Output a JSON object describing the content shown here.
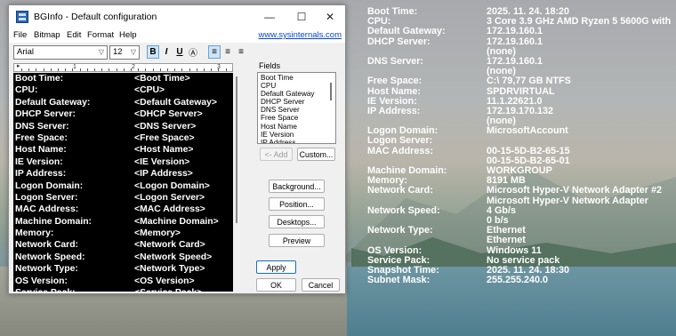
{
  "window": {
    "title": "BGInfo - Default configuration",
    "controls": {
      "minimize": "—",
      "maximize": "☐",
      "close": "✕"
    }
  },
  "menubar": {
    "items": [
      "File",
      "Bitmap",
      "Edit",
      "Format",
      "Help"
    ],
    "link": "www.sysinternals.com"
  },
  "toolbar": {
    "font_name": "Arial",
    "font_size": "12",
    "buttons": {
      "bold": "B",
      "italic": "I",
      "underline": "U",
      "format": "Ⓐ",
      "align_left": "≡",
      "align_center": "≡",
      "align_right": "≡"
    }
  },
  "ruler": {
    "labels": [
      "1",
      "2",
      "3"
    ]
  },
  "editor": {
    "rows": [
      {
        "key": "Boot Time:",
        "value": "<Boot Time>"
      },
      {
        "key": "CPU:",
        "value": "<CPU>"
      },
      {
        "key": "Default Gateway:",
        "value": "<Default Gateway>"
      },
      {
        "key": "DHCP Server:",
        "value": "<DHCP Server>"
      },
      {
        "key": "DNS Server:",
        "value": "<DNS Server>"
      },
      {
        "key": "Free Space:",
        "value": "<Free Space>"
      },
      {
        "key": "Host Name:",
        "value": "<Host Name>"
      },
      {
        "key": "IE Version:",
        "value": "<IE Version>"
      },
      {
        "key": "IP Address:",
        "value": "<IP Address>"
      },
      {
        "key": "Logon Domain:",
        "value": "<Logon Domain>"
      },
      {
        "key": "Logon Server:",
        "value": "<Logon Server>"
      },
      {
        "key": "MAC Address:",
        "value": "<MAC Address>"
      },
      {
        "key": "Machine Domain:",
        "value": "<Machine Domain>"
      },
      {
        "key": "Memory:",
        "value": "<Memory>"
      },
      {
        "key": "Network Card:",
        "value": "<Network Card>"
      },
      {
        "key": "Network Speed:",
        "value": "<Network Speed>"
      },
      {
        "key": "Network Type:",
        "value": "<Network Type>"
      },
      {
        "key": "OS Version:",
        "value": "<OS Version>"
      },
      {
        "key": "Service Pack:",
        "value": "<Service Pack>"
      }
    ]
  },
  "fields": {
    "label": "Fields",
    "items": [
      "Boot Time",
      "CPU",
      "Default Gateway",
      "DHCP Server",
      "DNS Server",
      "Free Space",
      "Host Name",
      "IE Version",
      "IP Address"
    ]
  },
  "buttons": {
    "add": "<- Add",
    "custom": "Custom...",
    "background": "Background...",
    "position": "Position...",
    "desktops": "Desktops...",
    "preview": "Preview",
    "apply": "Apply",
    "ok": "OK",
    "cancel": "Cancel"
  },
  "desktop_info": {
    "rows": [
      {
        "key": "Boot Time:",
        "value": "2025. 11. 24. 18:20"
      },
      {
        "key": "CPU:",
        "value": "3 Core 3.9 GHz AMD Ryzen 5 5600G with"
      },
      {
        "key": "Default Gateway:",
        "value": "172.19.160.1"
      },
      {
        "key": "DHCP Server:",
        "value": "172.19.160.1"
      },
      {
        "key": "",
        "value": "(none)"
      },
      {
        "key": "DNS Server:",
        "value": "172.19.160.1"
      },
      {
        "key": "",
        "value": "(none)"
      },
      {
        "key": "Free Space:",
        "value": "C:\\ 79,77 GB NTFS"
      },
      {
        "key": "Host Name:",
        "value": "SPDRVIRTUAL"
      },
      {
        "key": "IE Version:",
        "value": "11.1.22621.0"
      },
      {
        "key": "IP Address:",
        "value": "172.19.170.132"
      },
      {
        "key": "",
        "value": "(none)"
      },
      {
        "key": "Logon Domain:",
        "value": "MicrosoftAccount"
      },
      {
        "key": "Logon Server:",
        "value": ""
      },
      {
        "key": "MAC Address:",
        "value": "00-15-5D-B2-65-15"
      },
      {
        "key": "",
        "value": "00-15-5D-B2-65-01"
      },
      {
        "key": "Machine Domain:",
        "value": "WORKGROUP"
      },
      {
        "key": "Memory:",
        "value": "8191 MB"
      },
      {
        "key": "Network Card:",
        "value": "Microsoft Hyper-V Network Adapter #2"
      },
      {
        "key": "",
        "value": "Microsoft Hyper-V Network Adapter"
      },
      {
        "key": "Network Speed:",
        "value": "4 Gb/s"
      },
      {
        "key": "",
        "value": "0 b/s"
      },
      {
        "key": "Network Type:",
        "value": "Ethernet"
      },
      {
        "key": "",
        "value": "Ethernet"
      },
      {
        "key": "OS Version:",
        "value": "Windows 11"
      },
      {
        "key": "Service Pack:",
        "value": "No service pack"
      },
      {
        "key": "Snapshot Time:",
        "value": "2025. 11. 24. 18:30"
      },
      {
        "key": "Subnet Mask:",
        "value": "255.255.240.0"
      }
    ]
  }
}
